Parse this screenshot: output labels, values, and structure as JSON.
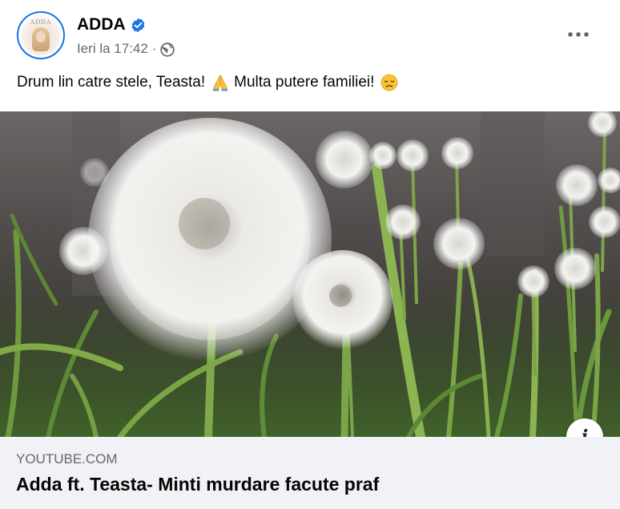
{
  "post": {
    "author": {
      "name": "ADDA",
      "avatar_text": "ADDA",
      "verified_icon": "verified-badge-icon",
      "verified_color": "#1b74e4"
    },
    "timestamp": "Ieri la 17:42",
    "separator": "·",
    "audience_icon": "globe-icon",
    "more_icon": "more-options-icon",
    "caption": {
      "part1": "Drum lin catre stele, Teasta!",
      "emoji1": "🙏",
      "part2": "Multa putere familiei!",
      "emoji2": "😞"
    },
    "media": {
      "description_icon": "dandelion-photo",
      "info_icon": "info-icon",
      "info_label": "i"
    },
    "link_preview": {
      "domain": "YOUTUBE.COM",
      "title": "Adda ft. Teasta- Minti murdare facute praf"
    }
  }
}
